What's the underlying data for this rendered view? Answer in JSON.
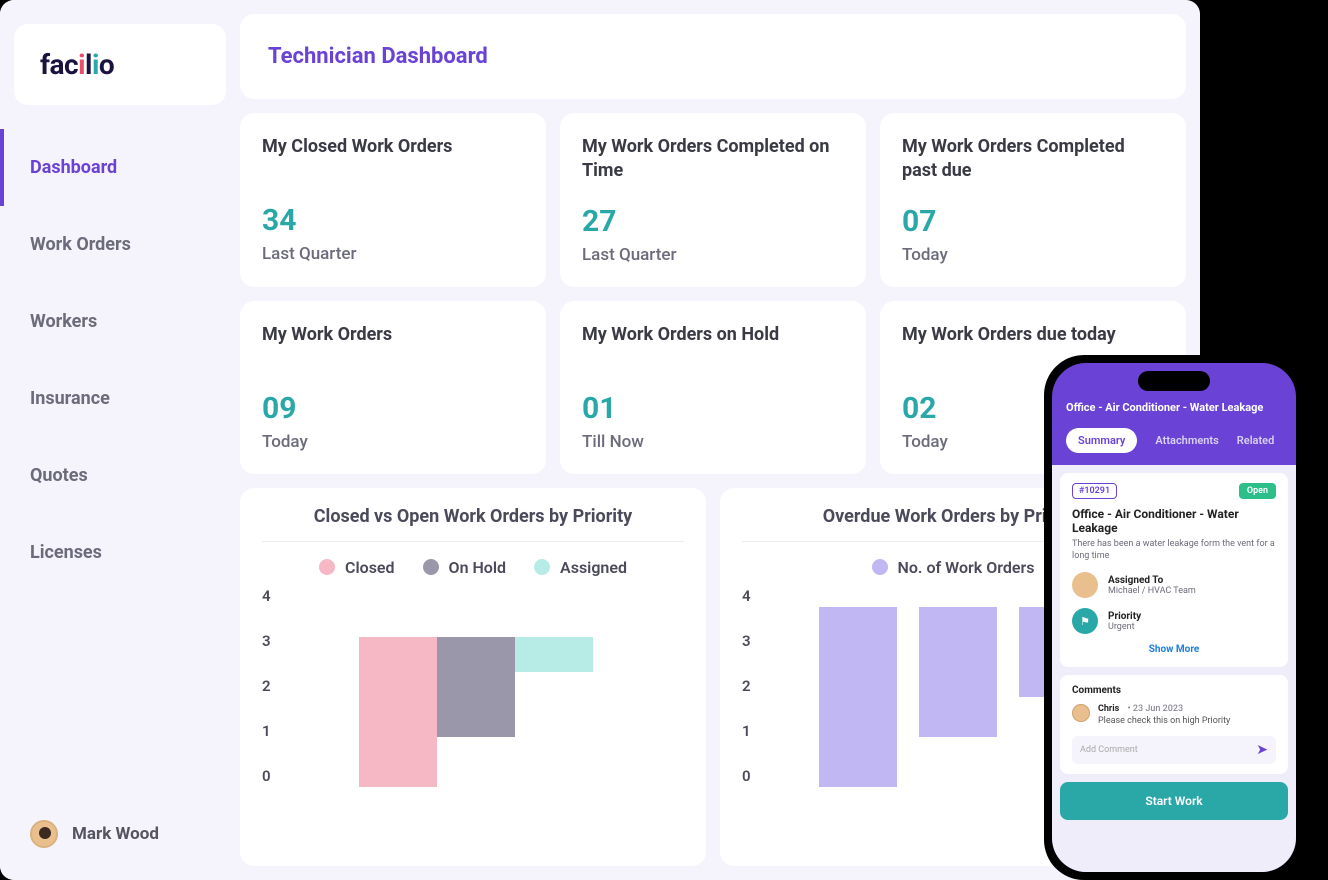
{
  "brand": {
    "name": "facilio"
  },
  "sidebar": {
    "items": [
      {
        "label": "Dashboard",
        "active": true
      },
      {
        "label": "Work Orders"
      },
      {
        "label": "Workers"
      },
      {
        "label": "Insurance"
      },
      {
        "label": "Quotes"
      },
      {
        "label": "Licenses"
      }
    ],
    "user": {
      "name": "Mark Wood"
    }
  },
  "header": {
    "title": "Technician Dashboard"
  },
  "stats": [
    {
      "title": "My Closed Work Orders",
      "value": "34",
      "sub": "Last Quarter"
    },
    {
      "title": "My Work Orders Completed on Time",
      "value": "27",
      "sub": "Last Quarter"
    },
    {
      "title": "My Work Orders Completed past due",
      "value": "07",
      "sub": "Today"
    },
    {
      "title": "My Work Orders",
      "value": "09",
      "sub": "Today"
    },
    {
      "title": "My Work Orders on Hold",
      "value": "01",
      "sub": "Till Now"
    },
    {
      "title": "My Work Orders due today",
      "value": "02",
      "sub": "Today"
    }
  ],
  "charts": {
    "left": {
      "title": "Closed vs Open Work Orders by Priority",
      "legend": [
        "Closed",
        "On Hold",
        "Assigned"
      ]
    },
    "right": {
      "title": "Overdue Work Orders by Priority",
      "legend": [
        "No. of Work Orders"
      ]
    },
    "yticks": [
      "4",
      "3",
      "2",
      "1",
      "0"
    ]
  },
  "chart_data": [
    {
      "type": "bar",
      "title": "Closed vs Open Work Orders by Priority",
      "ylabel": "",
      "ylim": [
        0,
        4
      ],
      "categories": [
        ""
      ],
      "series": [
        {
          "name": "Closed",
          "values": [
            3.0
          ],
          "color": "#f7b8c6"
        },
        {
          "name": "On Hold",
          "values": [
            2.0
          ],
          "color": "#9b97ab"
        },
        {
          "name": "Assigned",
          "values": [
            0.7
          ],
          "color": "#b6ece5"
        }
      ]
    },
    {
      "type": "bar",
      "title": "Overdue Work Orders by Priority",
      "ylabel": "",
      "ylim": [
        0,
        4
      ],
      "categories": [
        "",
        "",
        ""
      ],
      "series": [
        {
          "name": "No. of Work Orders",
          "values": [
            3.6,
            2.6,
            1.8
          ],
          "color": "#c1b7f3"
        }
      ]
    }
  ],
  "phone": {
    "title": "Office - Air Conditioner - Water Leakage",
    "tabs": [
      "Summary",
      "Attachments",
      "Related"
    ],
    "wo": {
      "id": "#10291",
      "status": "Open",
      "title": "Office - Air Conditioner - Water Leakage",
      "desc": "There has been a water leakage form the vent for a long time",
      "assigned_label": "Assigned To",
      "assigned_value": "Michael / HVAC Team",
      "priority_label": "Priority",
      "priority_value": "Urgent",
      "show_more": "Show More",
      "priority_flag": "⚑"
    },
    "comments": {
      "heading": "Comments",
      "author": "Chris",
      "date": "23 Jun 2023",
      "body": "Please check this on high Priority",
      "placeholder": "Add Comment",
      "send_glyph": "➤"
    },
    "start_button": "Start Work"
  }
}
